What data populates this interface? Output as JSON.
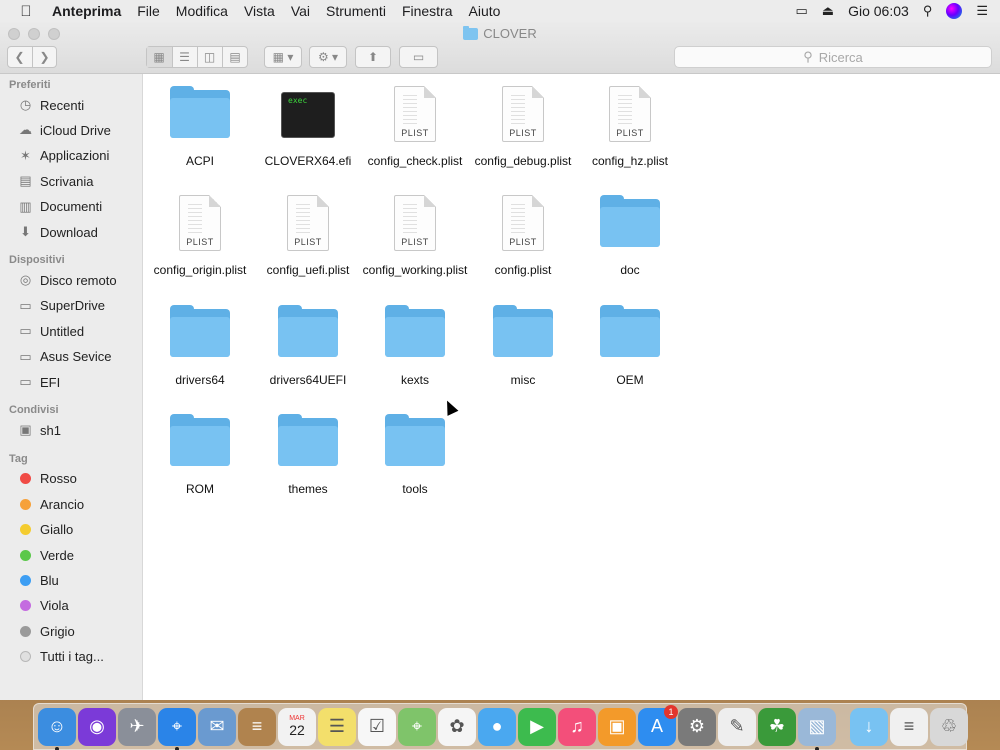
{
  "menubar": {
    "apple_icon": "apple-logo",
    "items": [
      "Anteprima",
      "File",
      "Modifica",
      "Vista",
      "Vai",
      "Strumenti",
      "Finestra",
      "Aiuto"
    ],
    "clock": "Gio 06:03",
    "status_icons": [
      "display-mirroring-icon",
      "eject-icon",
      "search-icon",
      "siri-icon",
      "notification-center-icon"
    ]
  },
  "window": {
    "title": "CLOVER",
    "search_placeholder": "Ricerca",
    "toolbar_icons": [
      "back-icon",
      "forward-icon",
      "icon-view-icon",
      "list-view-icon",
      "column-view-icon",
      "gallery-view-icon",
      "group-icon",
      "action-gear-icon",
      "share-icon",
      "tag-icon"
    ]
  },
  "sidebar": {
    "favorites_header": "Preferiti",
    "favorites": [
      {
        "label": "Recenti",
        "icon": "clock-icon"
      },
      {
        "label": "iCloud Drive",
        "icon": "cloud-icon"
      },
      {
        "label": "Applicazioni",
        "icon": "applications-icon"
      },
      {
        "label": "Scrivania",
        "icon": "desktop-icon"
      },
      {
        "label": "Documenti",
        "icon": "documents-icon"
      },
      {
        "label": "Download",
        "icon": "download-icon"
      }
    ],
    "devices_header": "Dispositivi",
    "devices": [
      {
        "label": "Disco remoto",
        "icon": "disc-icon"
      },
      {
        "label": "SuperDrive",
        "icon": "drive-icon"
      },
      {
        "label": "Untitled",
        "icon": "drive-icon"
      },
      {
        "label": "Asus Sevice",
        "icon": "drive-icon"
      },
      {
        "label": "EFI",
        "icon": "drive-icon"
      }
    ],
    "shared_header": "Condivisi",
    "shared": [
      {
        "label": "sh1",
        "icon": "computer-icon"
      }
    ],
    "tags_header": "Tag",
    "tags": [
      {
        "label": "Rosso",
        "color": "#f04b45"
      },
      {
        "label": "Arancio",
        "color": "#f6a13a"
      },
      {
        "label": "Giallo",
        "color": "#f4cc2f"
      },
      {
        "label": "Verde",
        "color": "#5bc84a"
      },
      {
        "label": "Blu",
        "color": "#3d9ef3"
      },
      {
        "label": "Viola",
        "color": "#c46be0"
      },
      {
        "label": "Grigio",
        "color": "#9a9a9a"
      },
      {
        "label": "Tutti i tag...",
        "color": "#e0e0e0"
      }
    ]
  },
  "files": [
    {
      "name": "ACPI",
      "kind": "folder"
    },
    {
      "name": "CLOVERX64.efi",
      "kind": "exec",
      "icon_text": "exec"
    },
    {
      "name": "config_check.plist",
      "kind": "plist",
      "icon_text": "PLIST"
    },
    {
      "name": "config_debug.plist",
      "kind": "plist",
      "icon_text": "PLIST"
    },
    {
      "name": "config_hz.plist",
      "kind": "plist",
      "icon_text": "PLIST"
    },
    {
      "name": "config_origin.plist",
      "kind": "plist",
      "icon_text": "PLIST"
    },
    {
      "name": "config_uefi.plist",
      "kind": "plist",
      "icon_text": "PLIST"
    },
    {
      "name": "config_working.plist",
      "kind": "plist",
      "icon_text": "PLIST"
    },
    {
      "name": "config.plist",
      "kind": "plist",
      "icon_text": "PLIST"
    },
    {
      "name": "doc",
      "kind": "folder"
    },
    {
      "name": "drivers64",
      "kind": "folder"
    },
    {
      "name": "drivers64UEFI",
      "kind": "folder"
    },
    {
      "name": "kexts",
      "kind": "folder"
    },
    {
      "name": "misc",
      "kind": "folder"
    },
    {
      "name": "OEM",
      "kind": "folder"
    },
    {
      "name": "ROM",
      "kind": "folder"
    },
    {
      "name": "themes",
      "kind": "folder"
    },
    {
      "name": "tools",
      "kind": "folder"
    }
  ],
  "dock": {
    "apps": [
      {
        "name": "finder-icon",
        "color": "#3b8de0",
        "running": true
      },
      {
        "name": "siri-icon",
        "color": "#7b3ad8",
        "running": false
      },
      {
        "name": "launchpad-icon",
        "color": "#8a8f99",
        "running": false
      },
      {
        "name": "safari-icon",
        "color": "#2a84e8",
        "running": true
      },
      {
        "name": "mail-stamp-icon",
        "color": "#6a9ad0",
        "running": false
      },
      {
        "name": "contacts-icon",
        "color": "#b0834e",
        "running": false
      },
      {
        "name": "calendar-icon",
        "color": "#f2f2f2",
        "running": false,
        "text_top": "MAR",
        "text": "22"
      },
      {
        "name": "notes-icon",
        "color": "#f3df6b",
        "running": false
      },
      {
        "name": "reminders-icon",
        "color": "#f7f7f7",
        "running": false
      },
      {
        "name": "maps-icon",
        "color": "#7fc46a",
        "running": false
      },
      {
        "name": "photos-icon",
        "color": "#f5f5f5",
        "running": false
      },
      {
        "name": "messages-icon",
        "color": "#4aa8f0",
        "running": false
      },
      {
        "name": "facetime-icon",
        "color": "#3dbb4e",
        "running": false
      },
      {
        "name": "itunes-icon",
        "color": "#f34f7a",
        "running": false
      },
      {
        "name": "ibooks-icon",
        "color": "#f39a2a",
        "running": false
      },
      {
        "name": "app-store-icon",
        "color": "#2e8df0",
        "running": false,
        "badge": "1"
      },
      {
        "name": "system-preferences-icon",
        "color": "#7a7a7a",
        "running": false
      },
      {
        "name": "textedit-icon",
        "color": "#eeeeee",
        "running": false
      },
      {
        "name": "clover-configurator-icon",
        "color": "#3a9a3a",
        "running": false
      },
      {
        "name": "preview-icon",
        "color": "#9ab8d8",
        "running": true
      }
    ],
    "right": [
      {
        "name": "downloads-folder-icon",
        "color": "#78c2f2"
      },
      {
        "name": "document-stack-icon",
        "color": "#f0f0f0"
      },
      {
        "name": "trash-icon",
        "color": "#d8d8d8"
      }
    ]
  }
}
